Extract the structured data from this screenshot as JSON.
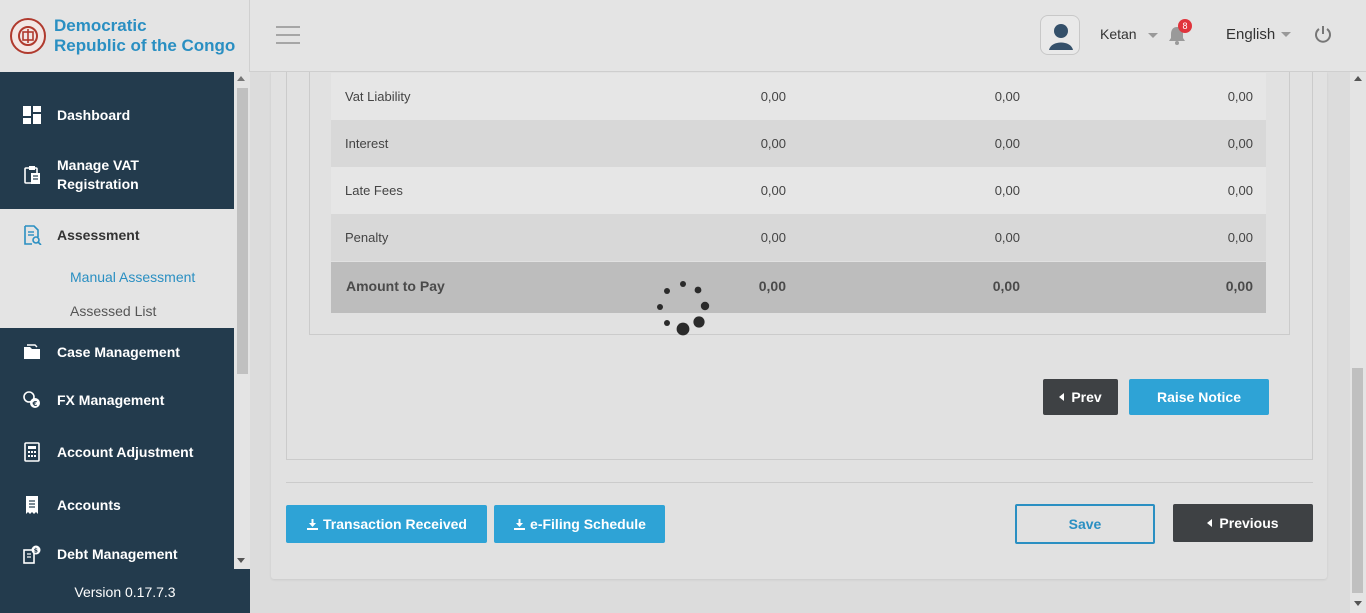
{
  "header": {
    "brand_line1": "Democratic",
    "brand_line2": "Republic of the Congo",
    "user_name": "Ketan",
    "notification_count": "8",
    "language": "English"
  },
  "sidebar": {
    "items": [
      {
        "label": "Dashboard",
        "icon": "dashboard-icon"
      },
      {
        "label": "Manage VAT Registration",
        "icon": "clipboard-icon"
      },
      {
        "label": "Assessment",
        "icon": "document-search-icon"
      },
      {
        "label": "Case Management",
        "icon": "folder-icon"
      },
      {
        "label": "FX Management",
        "icon": "currency-exchange-icon"
      },
      {
        "label": "Account Adjustment",
        "icon": "calculator-icon"
      },
      {
        "label": "Accounts",
        "icon": "receipt-icon"
      },
      {
        "label": "Debt Management",
        "icon": "debt-icon"
      }
    ],
    "subitems": [
      {
        "label": "Manual Assessment"
      },
      {
        "label": "Assessed List"
      }
    ],
    "version": "Version 0.17.7.3"
  },
  "table": {
    "rows": [
      {
        "label": "Vat Liability",
        "c1": "0,00",
        "c2": "0,00",
        "c3": "0,00"
      },
      {
        "label": "Interest",
        "c1": "0,00",
        "c2": "0,00",
        "c3": "0,00"
      },
      {
        "label": "Late Fees",
        "c1": "0,00",
        "c2": "0,00",
        "c3": "0,00"
      },
      {
        "label": "Penalty",
        "c1": "0,00",
        "c2": "0,00",
        "c3": "0,00"
      }
    ],
    "total": {
      "label": "Amount to Pay",
      "c1": "0,00",
      "c2": "0,00",
      "c3": "0,00"
    }
  },
  "actions": {
    "prev_label": "Prev",
    "raise_notice_label": "Raise Notice",
    "transaction_received_label": "Transaction Received",
    "efiling_schedule_label": "e-Filing Schedule",
    "save_label": "Save",
    "previous_label": "Previous"
  },
  "colors": {
    "sidebar_bg": "#233b4d",
    "accent_blue": "#2ea3d6",
    "dark_button": "#3e4144",
    "badge_red": "#e0343c"
  }
}
